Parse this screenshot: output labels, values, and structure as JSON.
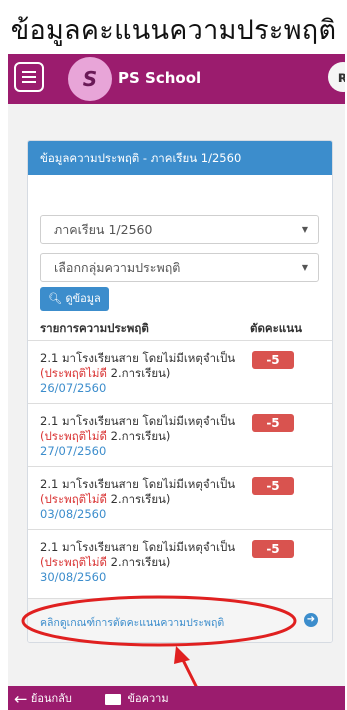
{
  "heading": "ข้อมูลคะแนนความประพฤติ",
  "navbar": {
    "brand": "PS School",
    "logo_text": "S"
  },
  "card": {
    "header": "ข้อมูลความประพฤติ - ภาคเรียน 1/2560",
    "term_select": "ภาคเรียน 1/2560",
    "group_select_placeholder": "เลือกกลุ่มความประพฤติ",
    "view_button": "ดูข้อมูล",
    "col_item": "รายการความประพฤติ",
    "col_deduct": "ตัดคะแนน",
    "rows": [
      {
        "title": "2.1 มาโรงเรียนสาย โดยไม่มีเหตุจำเป็น",
        "type": "(ประพฤติไม่ดี",
        "category": " 2.การเรียน)",
        "date": "26/07/2560",
        "points": "-5"
      },
      {
        "title": "2.1 มาโรงเรียนสาย โดยไม่มีเหตุจำเป็น",
        "type": "(ประพฤติไม่ดี",
        "category": " 2.การเรียน)",
        "date": "27/07/2560",
        "points": "-5"
      },
      {
        "title": "2.1 มาโรงเรียนสาย โดยไม่มีเหตุจำเป็น",
        "type": "(ประพฤติไม่ดี",
        "category": " 2.การเรียน)",
        "date": "03/08/2560",
        "points": "-5"
      },
      {
        "title": "2.1 มาโรงเรียนสาย โดยไม่มีเหตุจำเป็น",
        "type": "(ประพฤติไม่ดี",
        "category": " 2.การเรียน)",
        "date": "30/08/2560",
        "points": "-5"
      }
    ],
    "footer_link": "คลิกดูเกณฑ์การตัดคะแนนความประพฤติ"
  },
  "bottom_bar": {
    "back": "ย้อนกลับ",
    "message": "ข้อความ"
  },
  "icons": {
    "menu": "hamburger-icon",
    "help": "help-icon",
    "search": "search-icon",
    "arrow": "arrow-right-icon",
    "back": "arrow-left-icon",
    "envelope": "envelope-icon"
  },
  "colors": {
    "brand": "#9b1c6e",
    "primary": "#3c8dcc",
    "danger": "#d9534f"
  }
}
